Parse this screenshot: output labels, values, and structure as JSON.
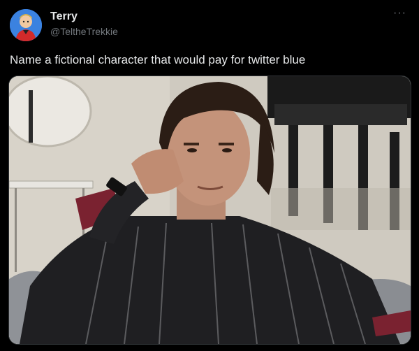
{
  "user": {
    "display_name": "Terry",
    "handle": "@TeltheTrekkie",
    "avatar": "cartoon-avatar"
  },
  "tweet": {
    "text": "Name a fictional character that would pay for twitter blue",
    "more_icon": "more-options-icon",
    "more_glyph": "···"
  },
  "media": {
    "subject": "photo"
  },
  "colors": {
    "background": "#000000",
    "primary_text": "#e7e9ea",
    "secondary_text": "#71767b",
    "border": "#2f3336"
  }
}
